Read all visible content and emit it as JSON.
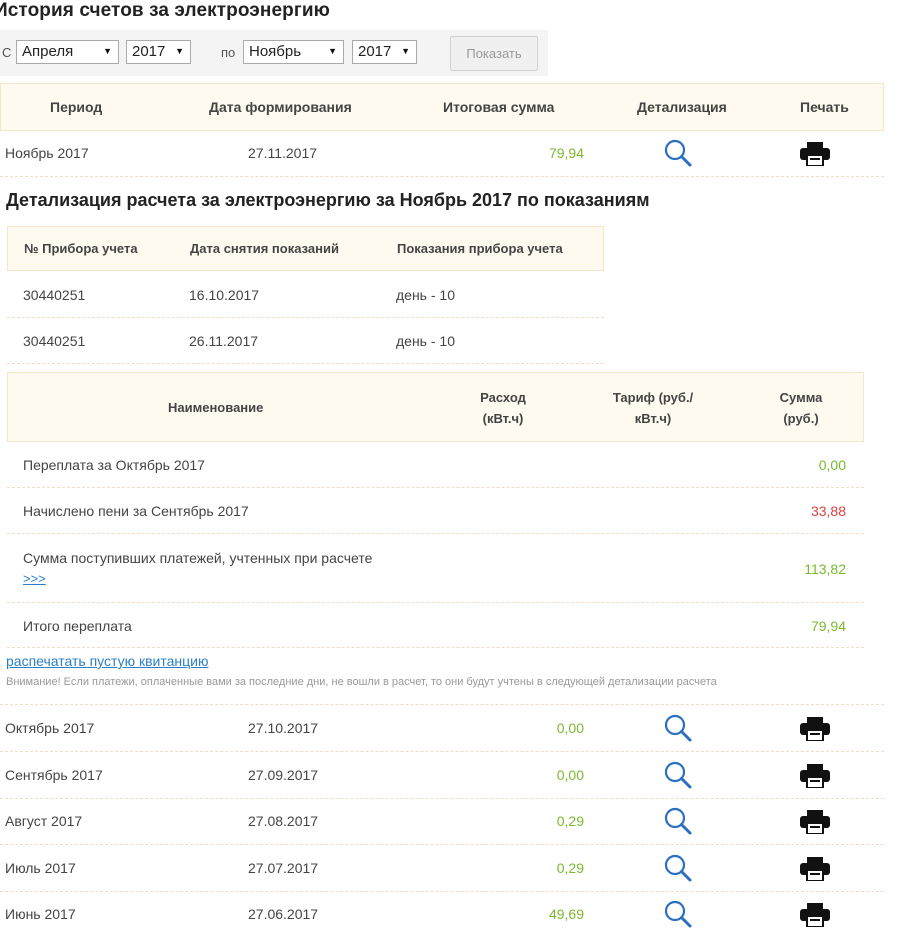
{
  "page_title": "История счетов за электроэнергию",
  "filter": {
    "from_label": "С",
    "from_month": "Апреля",
    "from_year": "2017",
    "to_label": "по",
    "to_month": "Ноябрь",
    "to_year": "2017",
    "show_button": "Показать"
  },
  "history_table": {
    "headers": {
      "period": "Период",
      "date": "Дата формирования",
      "total": "Итоговая сумма",
      "detail": "Детализация",
      "print": "Печать"
    },
    "current_row": {
      "period": "Ноябрь 2017",
      "date": "27.11.2017",
      "total": "79,94"
    },
    "rows": [
      {
        "period": "Октябрь 2017",
        "date": "27.10.2017",
        "total": "0,00"
      },
      {
        "period": "Сентябрь 2017",
        "date": "27.09.2017",
        "total": "0,00"
      },
      {
        "period": "Август 2017",
        "date": "27.08.2017",
        "total": "0,29"
      },
      {
        "period": "Июль 2017",
        "date": "27.07.2017",
        "total": "0,29"
      },
      {
        "period": "Июнь 2017",
        "date": "27.06.2017",
        "total": "49,69"
      }
    ],
    "detail_icon": "magnifier-icon",
    "print_icon": "printer-icon"
  },
  "detail": {
    "title": "Детализация расчета за электроэнергию за Ноябрь 2017 по показаниям",
    "device_table": {
      "headers": {
        "device": "№ Прибора учета",
        "date": "Дата снятия показаний",
        "reading": "Показания прибора учета"
      },
      "rows": [
        {
          "device": "30440251",
          "date": "16.10.2017",
          "reading": "день - 10"
        },
        {
          "device": "30440251",
          "date": "26.11.2017",
          "reading": "день - 10"
        }
      ]
    },
    "calc_table": {
      "headers": {
        "name": "Наименование",
        "usage_l1": "Расход",
        "usage_l2": "(кВт.ч)",
        "tariff_l1": "Тариф (руб./",
        "tariff_l2": "кВт.ч)",
        "sum_l1": "Сумма",
        "sum_l2": "(руб.)"
      },
      "rows": [
        {
          "name": "Переплата за Октябрь 2017",
          "value": "0,00"
        },
        {
          "name": "Начислено пени за Сентябрь 2017",
          "value": "33,88"
        },
        {
          "name": "Сумма поступивших платежей, учтенных при расчете",
          "link": ">>>",
          "value": "113,82"
        },
        {
          "name": "Итого переплата",
          "value": "79,94"
        }
      ]
    },
    "print_empty_link": "распечатать пустую квитанцию",
    "warning": "Внимание! Если платежи, оплаченные вами за последние дни, не вошли в расчет, то они будут учтены в следующей детализации расчета"
  },
  "colors": {
    "positive": "#7cb82f",
    "penalty": "#d9443f",
    "link": "#2a7fc8",
    "header_bg": "#fffaf0"
  }
}
